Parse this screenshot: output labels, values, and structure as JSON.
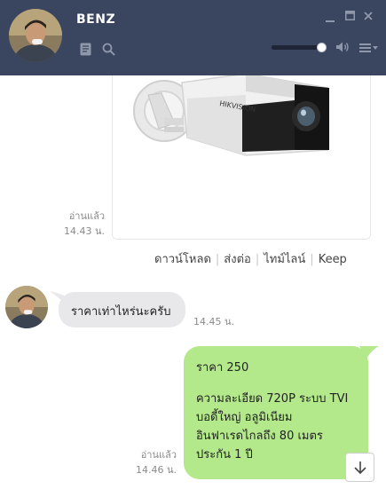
{
  "header": {
    "contact_name": "BENZ",
    "volume_level": 1.0,
    "background_color": "#3a4560"
  },
  "messages": {
    "image_message": {
      "read_status": "อ่านแล้ว",
      "time": "14.43 น.",
      "image_brand_text": "HIKVISION",
      "actions": [
        "ดาวน์โหลด",
        "ส่งต่อ",
        "ไทม์ไลน์",
        "Keep"
      ]
    },
    "incoming": {
      "text": "ราคาเท่าไหร่นะครับ",
      "time": "14.45 น."
    },
    "outgoing": {
      "lines": [
        "ราคา 250",
        "ความละเอียด 720P ระบบ TVI",
        "บอดี้ใหญ่ อลูมิเนียม",
        "อินฟาเรดไกลถึง 80 เมตร",
        "ประกัน 1 ปี"
      ],
      "read_status": "อ่านแล้ว",
      "time": "14.46 น."
    }
  },
  "colors": {
    "outgoing_bubble": "#b3e88b",
    "incoming_bubble": "#e8e8ea"
  },
  "icons": {
    "minimize": "minimize-icon",
    "maximize": "maximize-icon",
    "close": "close-icon",
    "notes": "notes-icon",
    "search": "search-icon",
    "speaker": "speaker-icon",
    "menu": "menu-icon",
    "scroll": "arrow-down-icon"
  }
}
